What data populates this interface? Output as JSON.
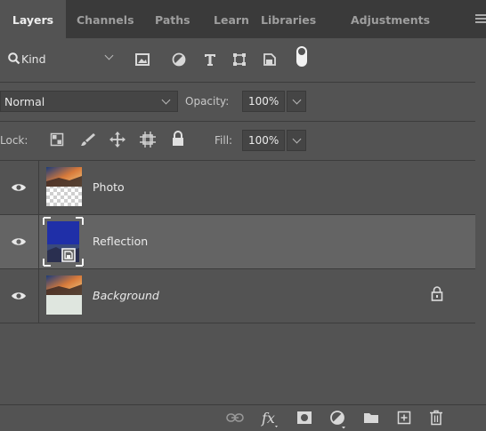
{
  "tabs": [
    "Layers",
    "Channels",
    "Paths",
    "Learn",
    "Libraries",
    "Adjustments"
  ],
  "filter": {
    "label": "Kind"
  },
  "blend": {
    "mode": "Normal",
    "opacity_label": "Opacity:",
    "opacity_value": "100%"
  },
  "lock": {
    "label": "Lock:",
    "fill_label": "Fill:",
    "fill_value": "100%"
  },
  "layers": [
    {
      "name": "Photo",
      "italic": false,
      "selected": false,
      "locked": false
    },
    {
      "name": "Reflection",
      "italic": false,
      "selected": true,
      "locked": false
    },
    {
      "name": "Background",
      "italic": true,
      "selected": false,
      "locked": true
    }
  ],
  "colors": {
    "panel": "#535353",
    "tabbar": "#3a3a3a",
    "selected": "#646464",
    "thumb_blue": "#1f2fa8"
  },
  "bottom_icons": [
    "link-icon",
    "fx-icon",
    "mask-icon",
    "adjustment-icon",
    "folder-icon",
    "new-layer-icon",
    "trash-icon"
  ]
}
